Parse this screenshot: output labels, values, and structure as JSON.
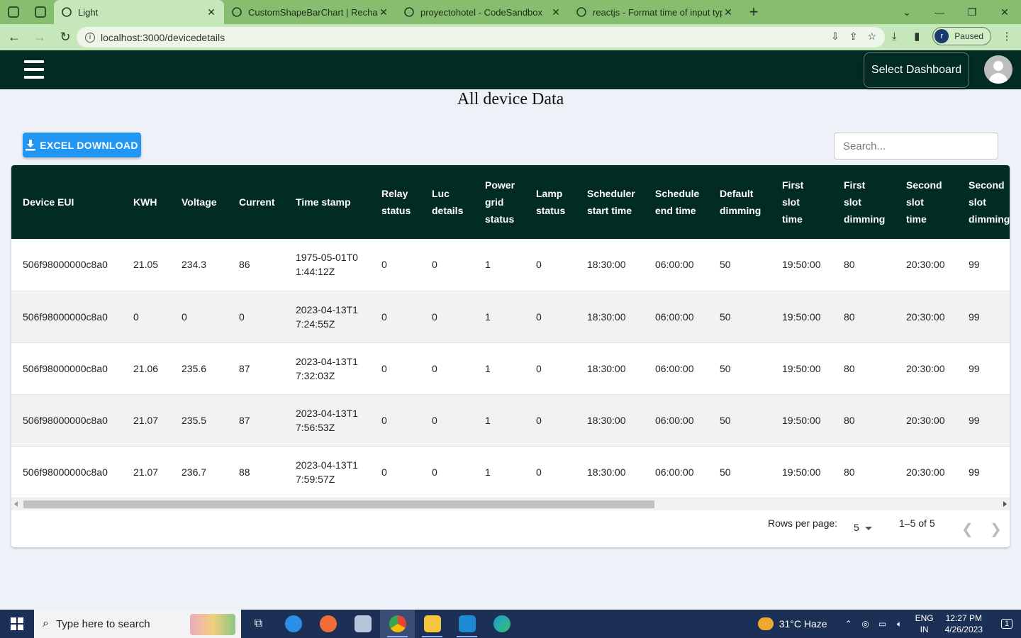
{
  "browser": {
    "tabs": [
      {
        "title": "Light",
        "icon": "react-icon",
        "active": true
      },
      {
        "title": "CustomShapeBarChart | Recharts",
        "icon": "globe-icon"
      },
      {
        "title": "proyectohotel - CodeSandbox",
        "icon": "codesandbox-icon"
      },
      {
        "title": "reactjs - Format time of input typ",
        "icon": "stackoverflow-icon"
      }
    ],
    "close_glyph": "✕",
    "new_tab_glyph": "+",
    "url": "localhost:3000/devicedetails",
    "profile_initial": "r",
    "profile_status": "Paused",
    "theme_color": "#87bd6e"
  },
  "header": {
    "select_dashboard": "Select Dashboard",
    "bg_color": "#022b24"
  },
  "page": {
    "title": "All device Data",
    "excel_button": "EXCEL DOWNLOAD",
    "search_placeholder": "Search..."
  },
  "table": {
    "headers": [
      [
        "Device EUI"
      ],
      [
        "KWH"
      ],
      [
        "Voltage"
      ],
      [
        "Current"
      ],
      [
        "Time stamp"
      ],
      [
        "Relay",
        "status"
      ],
      [
        "Luc",
        "details"
      ],
      [
        "Power",
        "grid",
        "status"
      ],
      [
        "Lamp",
        "status"
      ],
      [
        "Scheduler",
        "start time"
      ],
      [
        "Schedule",
        "end time"
      ],
      [
        "Default",
        "dimming"
      ],
      [
        "First",
        "slot",
        "time"
      ],
      [
        "First",
        "slot",
        "dimming"
      ],
      [
        "Second",
        "slot",
        "time"
      ],
      [
        "Second",
        "slot",
        "dimming"
      ]
    ],
    "rows": [
      [
        "506f98000000c8a0",
        "21.05",
        "234.3",
        "86",
        "1975-05-01T01:44:12Z",
        "0",
        "0",
        "1",
        "0",
        "18:30:00",
        "06:00:00",
        "50",
        "19:50:00",
        "80",
        "20:30:00",
        "99"
      ],
      [
        "506f98000000c8a0",
        "0",
        "0",
        "0",
        "2023-04-13T17:24:55Z",
        "0",
        "0",
        "1",
        "0",
        "18:30:00",
        "06:00:00",
        "50",
        "19:50:00",
        "80",
        "20:30:00",
        "99"
      ],
      [
        "506f98000000c8a0",
        "21.06",
        "235.6",
        "87",
        "2023-04-13T17:32:03Z",
        "0",
        "0",
        "1",
        "0",
        "18:30:00",
        "06:00:00",
        "50",
        "19:50:00",
        "80",
        "20:30:00",
        "99"
      ],
      [
        "506f98000000c8a0",
        "21.07",
        "235.5",
        "87",
        "2023-04-13T17:56:53Z",
        "0",
        "0",
        "1",
        "0",
        "18:30:00",
        "06:00:00",
        "50",
        "19:50:00",
        "80",
        "20:30:00",
        "99"
      ],
      [
        "506f98000000c8a0",
        "21.07",
        "236.7",
        "88",
        "2023-04-13T17:59:57Z",
        "0",
        "0",
        "1",
        "0",
        "18:30:00",
        "06:00:00",
        "50",
        "19:50:00",
        "80",
        "20:30:00",
        "99"
      ]
    ]
  },
  "pagination": {
    "rows_per_page_label": "Rows per page:",
    "rows_per_page_value": "5",
    "range": "1–5 of 5"
  },
  "taskbar": {
    "search_placeholder": "Type here to search",
    "weather": "31°C  Haze",
    "lang_line1": "ENG",
    "lang_line2": "IN",
    "time": "12:27 PM",
    "date": "4/26/2023",
    "notification_count": "1"
  }
}
